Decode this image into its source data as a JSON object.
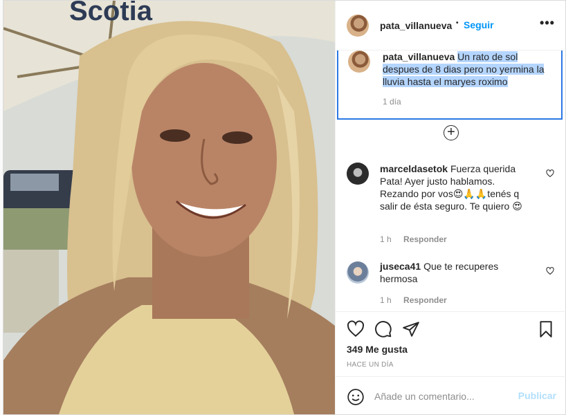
{
  "post": {
    "username": "pata_villanueva",
    "follow_label": "Seguir",
    "separator": "•",
    "more_label": "•••",
    "photo_sign_text": "Scotia",
    "caption": {
      "username": "pata_villanueva",
      "text": "Un rato de sol despues de 8 dias pero no yermina la lluvia hasta el maryes roximo",
      "time": "1 día"
    },
    "load_more_label": "+",
    "comments": [
      {
        "username": "marceldasetok",
        "text": "Fuerza querida Pata! Ayer justo hablamos. Rezando por vos😍🙏🙏tenés q salir de ésta seguro. Te quiero 😍",
        "time": "1 h",
        "reply_label": "Responder"
      },
      {
        "username": "juseca41",
        "text": "Que te recuperes hermosa",
        "time": "1 h",
        "reply_label": "Responder"
      }
    ],
    "likes": "349 Me gusta",
    "posted_ago": "HACE UN DÍA",
    "add_comment": {
      "placeholder": "Añade un comentario...",
      "publish_label": "Publicar"
    }
  },
  "colors": {
    "accent": "#0095f6",
    "publish_disabled": "#b2dffc",
    "selection_highlight": "#b4d5fe",
    "focus_border": "#2b78e4",
    "muted_text": "#8e8e8e"
  },
  "icons": [
    "more-icon",
    "plus-circle-icon",
    "heart-icon",
    "comment-icon",
    "share-icon",
    "bookmark-icon",
    "emoji-icon"
  ]
}
